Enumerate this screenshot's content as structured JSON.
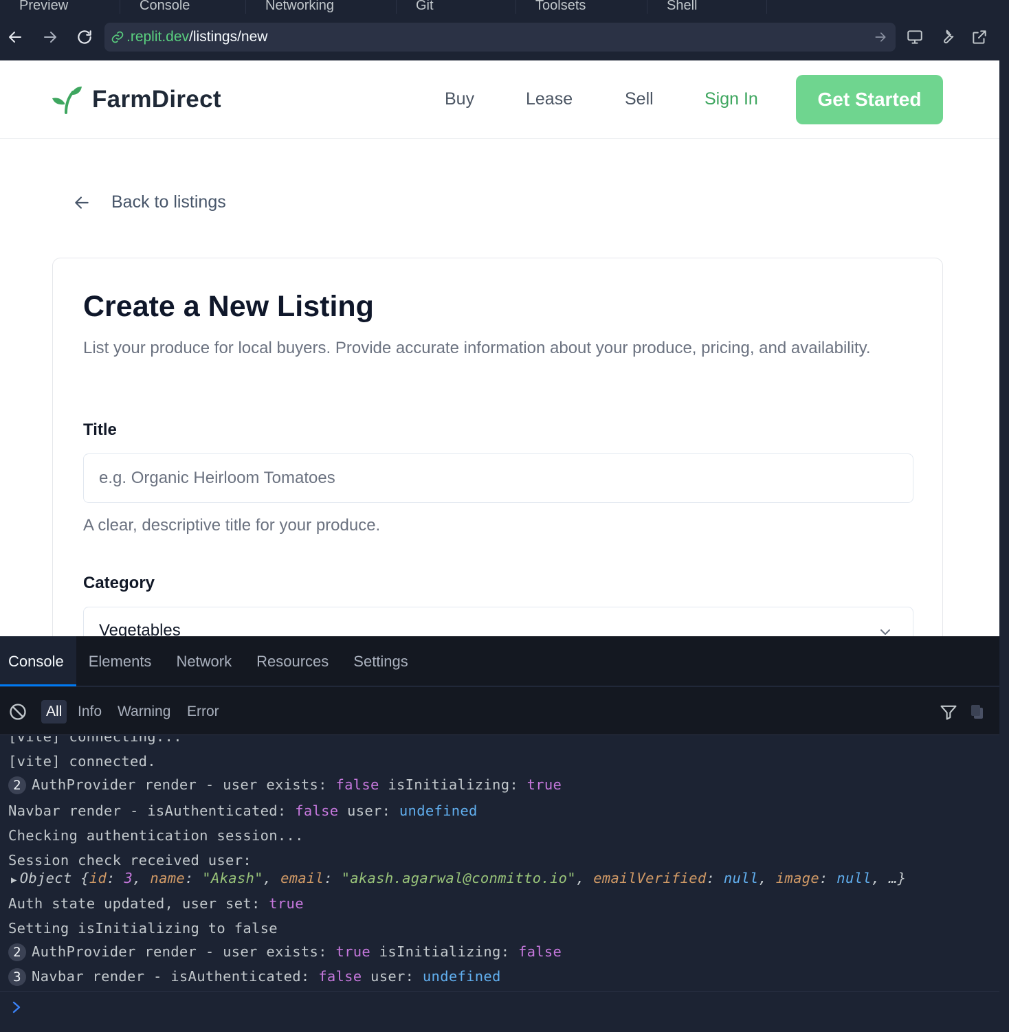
{
  "browser": {
    "tabs": [
      "Preview",
      "Console",
      "Networking",
      "Git",
      "Toolsets",
      "Shell"
    ],
    "url_host": ".replit.dev",
    "url_path": "/listings/new"
  },
  "site": {
    "brand": "FarmDirect",
    "nav": {
      "buy": "Buy",
      "lease": "Lease",
      "sell": "Sell",
      "sign_in": "Sign In",
      "get_started": "Get Started"
    },
    "back": "Back to listings",
    "form": {
      "title": "Create a New Listing",
      "description": "List your produce for local buyers. Provide accurate information about your produce, pricing, and availability.",
      "title_label": "Title",
      "title_placeholder": "e.g. Organic Heirloom Tomatoes",
      "title_hint": "A clear, descriptive title for your produce.",
      "category_label": "Category",
      "category_value": "Vegetables"
    }
  },
  "devtools": {
    "tabs": [
      "Console",
      "Elements",
      "Network",
      "Resources",
      "Settings"
    ],
    "active_tab": "Console",
    "filters": [
      "All",
      "Info",
      "Warning",
      "Error"
    ],
    "active_filter": "All",
    "logs": {
      "l0": "[vite] connecting...",
      "l1": "[vite] connected.",
      "l2_count": "2",
      "l2_text": "AuthProvider render - user exists: ",
      "l2_v1": "false",
      "l2_mid": " isInitializing: ",
      "l2_v2": "true",
      "l3_text": "Navbar render - isAuthenticated: ",
      "l3_v1": "false",
      "l3_mid": " user: ",
      "l3_v2": "undefined",
      "l4": "Checking authentication session...",
      "l5": "Session check received user:",
      "obj": {
        "prefix": "Object {",
        "k_id": "id",
        "v_id": "3",
        "k_name": "name",
        "v_name": "\"Akash\"",
        "k_email": "email",
        "v_email": "\"akash.agarwal@conmitto.io\"",
        "k_ev": "emailVerified",
        "v_ev": "null",
        "k_image": "image",
        "v_image": "null",
        "suffix": ", …}"
      },
      "l7_text": "Auth state updated, user set: ",
      "l7_v": "true",
      "l8": "Setting isInitializing to false",
      "l9_count": "2",
      "l9_text": "AuthProvider render - user exists: ",
      "l9_v1": "true",
      "l9_mid": " isInitializing: ",
      "l9_v2": "false",
      "l10_count": "3",
      "l10_text": "Navbar render - isAuthenticated: ",
      "l10_v1": "false",
      "l10_mid": " user: ",
      "l10_v2": "undefined"
    }
  },
  "colors": {
    "brand_green": "#3ea65f",
    "cta_green": "#6fd58f",
    "chrome_bg": "#1c2333",
    "accent_blue": "#0079f2"
  }
}
